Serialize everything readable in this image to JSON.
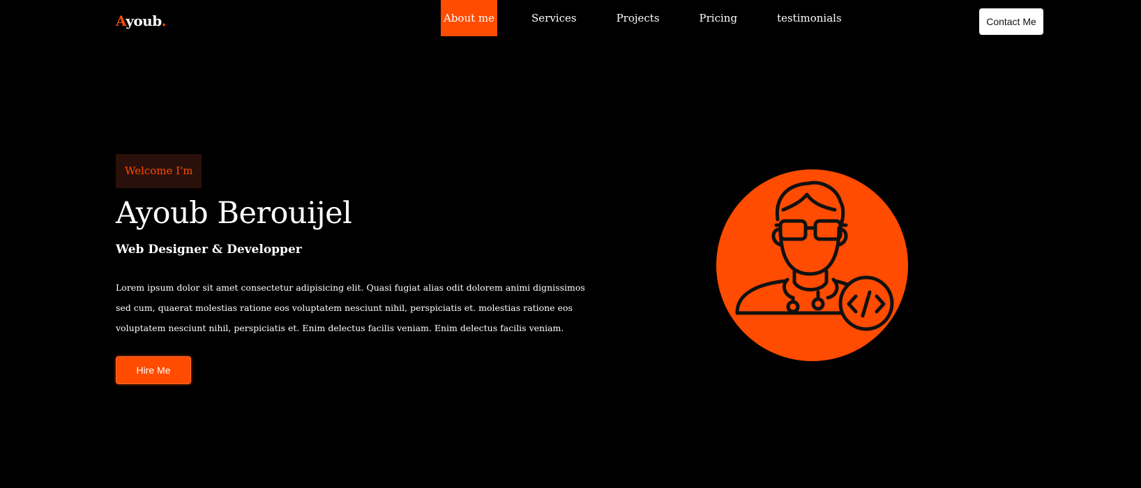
{
  "brand": {
    "logo_first": "A",
    "logo_rest": "youb",
    "logo_dot": ".",
    "accent_color": "#ff4c00"
  },
  "nav": {
    "items": [
      {
        "label": "About me",
        "active": true
      },
      {
        "label": "Services",
        "active": false
      },
      {
        "label": "Projects",
        "active": false
      },
      {
        "label": "Pricing",
        "active": false
      },
      {
        "label": "testimonials",
        "active": false
      }
    ],
    "contact_label": "Contact Me"
  },
  "hero": {
    "welcome": "Welcome I'm",
    "name": "Ayoub Berouijel",
    "role": "Web Designer & Developper",
    "description": "Lorem ipsum dolor sit amet consectetur adipisicing elit. Quasi fugiat alias odit dolorem animi dignissimos sed cum, quaerat molestias ratione eos voluptatem nesciunt nihil, perspiciatis et. molestias ratione eos voluptatem nesciunt nihil, perspiciatis et. Enim delectus facilis veniam. Enim delectus facilis veniam.",
    "hire_label": "Hire Me",
    "avatar_icon": "developer-avatar-icon"
  }
}
